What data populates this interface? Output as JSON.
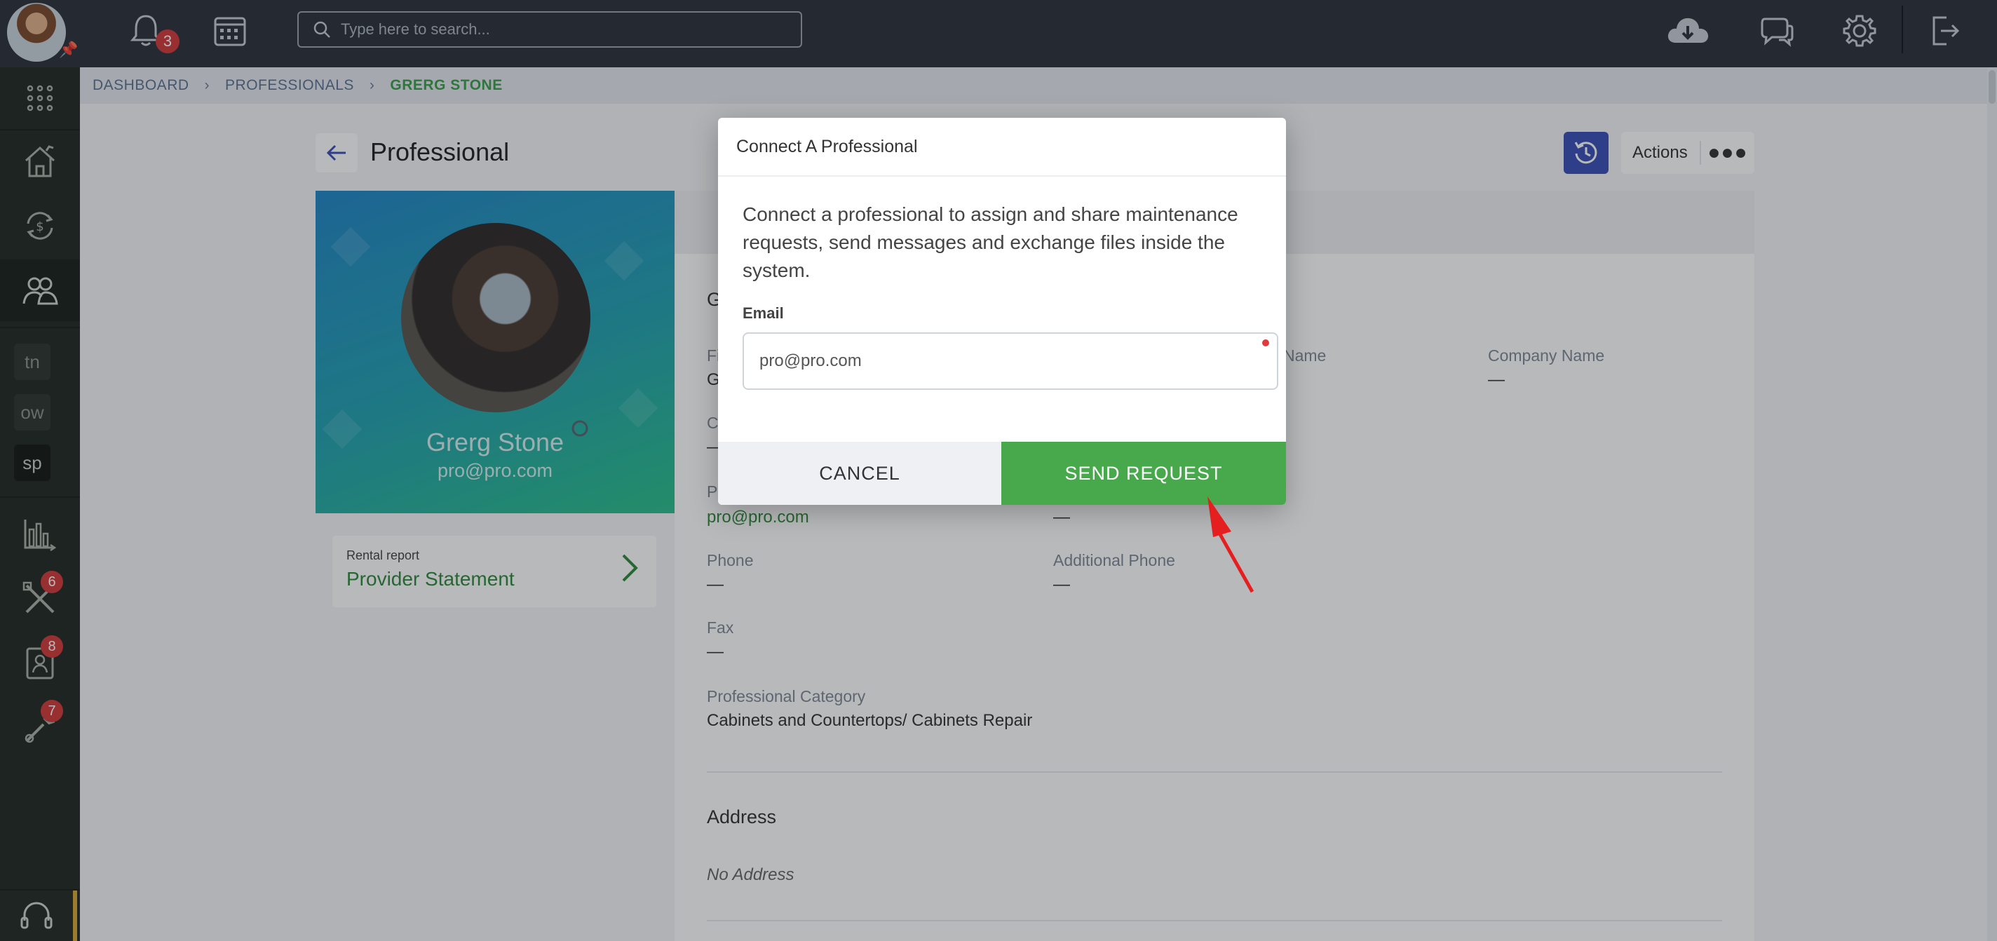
{
  "topbar": {
    "notification_count": "3",
    "search_placeholder": "Type here to search..."
  },
  "sidebar": {
    "tags": [
      "tn",
      "ow",
      "sp"
    ],
    "maintenance_badge": "6",
    "contacts_badge": "8",
    "tools_badge": "7"
  },
  "breadcrumb": {
    "items": [
      "DASHBOARD",
      "PROFESSIONALS"
    ],
    "current": "GRERG STONE"
  },
  "page": {
    "title": "Professional",
    "actions_label": "Actions"
  },
  "profile": {
    "name": "Grerg Stone",
    "email": "pro@pro.com"
  },
  "rental_report": {
    "small_label": "Rental report",
    "title": "Provider Statement"
  },
  "details": {
    "section_general_partial": "G",
    "first_label_partial": "Fi",
    "first_value_partial": "G",
    "c_label_partial": "C",
    "c_value": "—",
    "p_label_partial": "P",
    "name_label_partial": "Name",
    "company_label": "Company Name",
    "company_value": "—",
    "email_value": "pro@pro.com",
    "col2_value": "—",
    "phone_label": "Phone",
    "phone_value": "—",
    "additional_phone_label": "Additional Phone",
    "additional_phone_value": "—",
    "fax_label": "Fax",
    "fax_value": "—",
    "category_label": "Professional Category",
    "category_value": "Cabinets and Countertops/ Cabinets Repair",
    "address_title": "Address",
    "address_value": "No Address"
  },
  "modal": {
    "title": "Connect A Professional",
    "description": "Connect a professional to assign and share maintenance requests, send messages and exchange files inside the system.",
    "email_label": "Email",
    "email_value": "pro@pro.com",
    "cancel_label": "CANCEL",
    "send_label": "SEND REQUEST"
  },
  "colors": {
    "topbar": "#2b313b",
    "sidebar": "#232a23",
    "accent_green": "#47a94b",
    "refresh_blue": "#3c4fb8",
    "badge_red": "#d23a3a"
  }
}
